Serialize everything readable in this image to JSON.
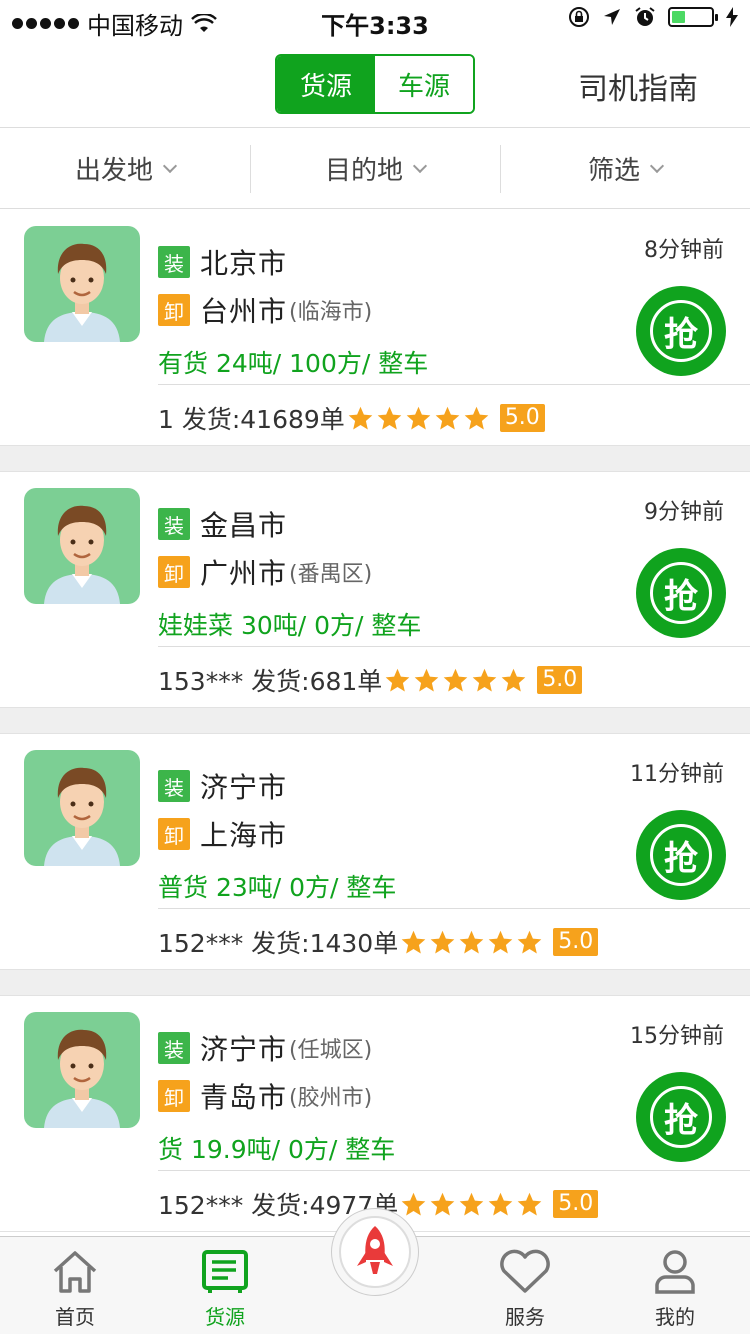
{
  "status_bar": {
    "carrier": "中国移动",
    "time": "下午3:33",
    "battery_level": 0.35
  },
  "nav": {
    "segments": [
      "货源",
      "车源"
    ],
    "active_segment": "货源",
    "guide_label": "司机指南"
  },
  "filters": [
    "出发地",
    "目的地",
    "筛选"
  ],
  "load_tag": "装",
  "unload_tag": "卸",
  "grab_label": "抢",
  "listings": [
    {
      "time_ago": "8分钟前",
      "origin": "北京市",
      "origin_district": "",
      "destination": "台州市",
      "destination_district": "(临海市)",
      "cargo": "有货  24吨/ 100方/ 整车",
      "shipper": "1 发货:41689单",
      "rating": "5.0",
      "stars": 5
    },
    {
      "time_ago": "9分钟前",
      "origin": "金昌市",
      "origin_district": "",
      "destination": "广州市",
      "destination_district": "(番禺区)",
      "cargo": "娃娃菜  30吨/ 0方/ 整车",
      "shipper": "153*** 发货:681单",
      "rating": "5.0",
      "stars": 5
    },
    {
      "time_ago": "11分钟前",
      "origin": "济宁市",
      "origin_district": "",
      "destination": "上海市",
      "destination_district": "",
      "cargo": "普货  23吨/ 0方/ 整车",
      "shipper": "152*** 发货:1430单",
      "rating": "5.0",
      "stars": 5
    },
    {
      "time_ago": "15分钟前",
      "origin": "济宁市",
      "origin_district": "(任城区)",
      "destination": "青岛市",
      "destination_district": "(胶州市)",
      "cargo": "货  19.9吨/ 0方/ 整车",
      "shipper": "152*** 发货:4977单",
      "rating": "5.0",
      "stars": 5
    }
  ],
  "tabs": [
    {
      "label": "首页",
      "icon": "home-icon"
    },
    {
      "label": "货源",
      "icon": "cargo-list-icon"
    },
    {
      "label": "",
      "icon": "rocket-icon"
    },
    {
      "label": "服务",
      "icon": "heart-icon"
    },
    {
      "label": "我的",
      "icon": "user-icon"
    }
  ],
  "colors": {
    "brand_green": "#10a31e",
    "load_tag": "#3cb54a",
    "unload_tag": "#f6a21c",
    "star": "#f6a21c"
  }
}
